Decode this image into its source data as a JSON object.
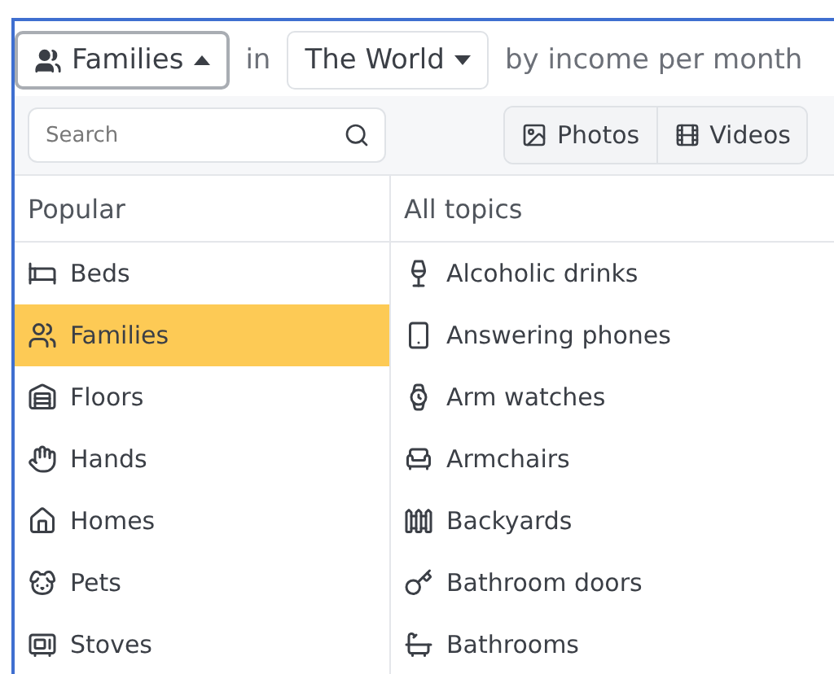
{
  "filter_bar": {
    "topic_dropdown": {
      "label": "Families",
      "expanded": true
    },
    "connector": "in",
    "region_dropdown": {
      "label": "The World",
      "expanded": false
    },
    "sort_text": "by income per month"
  },
  "toolbar": {
    "search": {
      "placeholder": "Search"
    },
    "media_tabs": [
      {
        "label": "Photos",
        "selected": false
      },
      {
        "label": "Videos",
        "selected": false
      }
    ]
  },
  "popular": {
    "heading": "Popular",
    "items": [
      {
        "label": "Beds",
        "selected": false
      },
      {
        "label": "Families",
        "selected": true
      },
      {
        "label": "Floors",
        "selected": false
      },
      {
        "label": "Hands",
        "selected": false
      },
      {
        "label": "Homes",
        "selected": false
      },
      {
        "label": "Pets",
        "selected": false
      },
      {
        "label": "Stoves",
        "selected": false
      }
    ]
  },
  "all_topics": {
    "heading": "All topics",
    "items": [
      {
        "label": "Alcoholic drinks"
      },
      {
        "label": "Answering phones"
      },
      {
        "label": "Arm watches"
      },
      {
        "label": "Armchairs"
      },
      {
        "label": "Backyards"
      },
      {
        "label": "Bathroom doors"
      },
      {
        "label": "Bathrooms"
      }
    ]
  }
}
